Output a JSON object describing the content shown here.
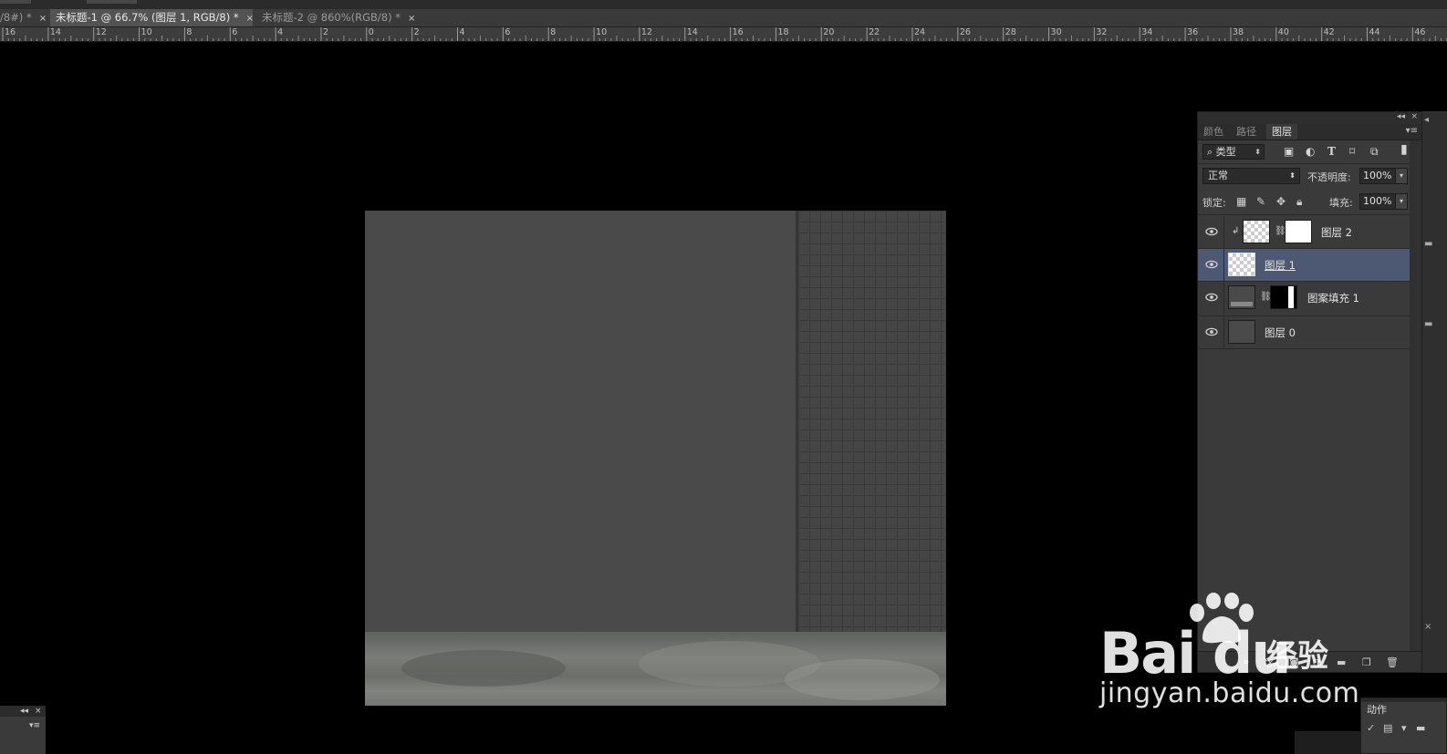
{
  "tabs": [
    {
      "label": "/8#) *",
      "close": "×",
      "active": false
    },
    {
      "label": "未标题-1 @ 66.7% (图层 1, RGB/8) *",
      "close": "×",
      "active": true
    },
    {
      "label": "未标题-2 @ 860%(RGB/8) *",
      "close": "×",
      "active": false
    }
  ],
  "ruler": {
    "labels": [
      "16",
      "14",
      "12",
      "10",
      "8",
      "6",
      "4",
      "2",
      "0",
      "2",
      "4",
      "6",
      "8",
      "10",
      "12",
      "14",
      "16",
      "18",
      "20",
      "22",
      "24",
      "26",
      "28",
      "30",
      "32",
      "34",
      "36",
      "38",
      "40",
      "42",
      "44",
      "46"
    ]
  },
  "panel": {
    "collapse_icon": "◂◂",
    "close_icon": "×",
    "tabs": [
      {
        "label": "颜色",
        "active": false
      },
      {
        "label": "路径",
        "active": false
      },
      {
        "label": "图层",
        "active": true
      }
    ],
    "menu_icon": "▾≡",
    "filter": {
      "label": "类型",
      "icon": "search-icon"
    },
    "blend_mode": "正常",
    "opacity_label": "不透明度:",
    "opacity_value": "100%",
    "lock_label": "锁定:",
    "fill_label": "填充:",
    "fill_value": "100%",
    "layers": [
      {
        "name": "图层 2",
        "visible": true,
        "selected": false,
        "thumb": "checker",
        "mask": "white",
        "clipped": true
      },
      {
        "name": "图层 1",
        "visible": true,
        "selected": true,
        "thumb": "checker",
        "mask": null,
        "clipped": false
      },
      {
        "name": "图案填充 1",
        "visible": true,
        "selected": false,
        "thumb": "pattern",
        "mask": "black-with-white-strip",
        "clipped": false
      },
      {
        "name": "图层 0",
        "visible": true,
        "selected": false,
        "thumb": "gray",
        "mask": null,
        "clipped": false
      }
    ]
  },
  "actions_panel": {
    "tab_label": "动作"
  },
  "watermark": {
    "brand": "Bai du",
    "brand_cn": "经验",
    "url": "jingyan.baidu.com"
  },
  "colors": {
    "canvas_gray": "#4a4a4a",
    "selected_layer": "#4d5972",
    "panel_bg": "#3a3a3a"
  }
}
